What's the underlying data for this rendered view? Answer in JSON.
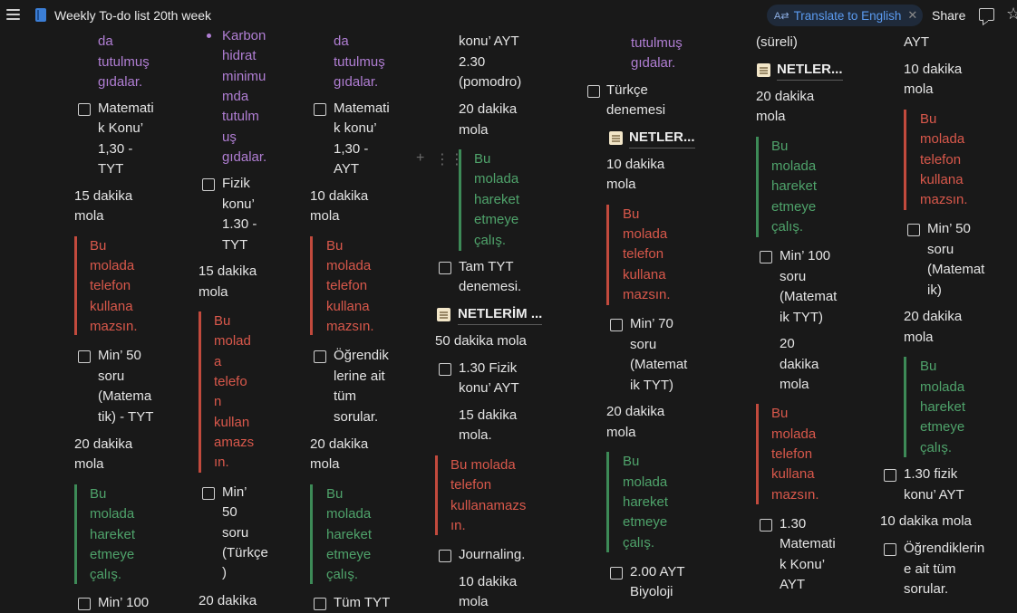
{
  "header": {
    "title": "Weekly To-do list 20th week",
    "translate_label": "Translate to English",
    "translate_icon": "translate-icon",
    "close_icon": "close-icon",
    "share_label": "Share",
    "comment_icon": "comment-icon",
    "favorite_icon": "star-icon"
  },
  "colors": {
    "background": "#191919",
    "purple": "#b07ed3",
    "red": "#d9584b",
    "green": "#4fa36b",
    "accent": "#5b9bf0"
  },
  "c1": {
    "p1": "da",
    "p2": "tutulmuş",
    "p3": "gıdalar.",
    "task1": [
      "Matemati",
      "k Konu’",
      "1,30 -",
      "TYT"
    ],
    "m1": [
      "15 dakika",
      "mola"
    ],
    "red1": [
      "Bu",
      "molada",
      "telefon",
      "kullana",
      "mazsın."
    ],
    "task2": [
      "Min’ 50",
      "soru",
      "(Matema",
      "tik) - TYT"
    ],
    "m2": [
      "20 dakika",
      "mola"
    ],
    "green1": [
      "Bu",
      "molada",
      "hareket",
      "etmeye",
      "çalış."
    ],
    "task3": "Min’ 100"
  },
  "c2": {
    "purple": [
      "Karbon",
      "hidrat",
      "minimu",
      "mda",
      "tutulm",
      "uş",
      "gıdalar."
    ],
    "task1": [
      "Fizik",
      "konu’",
      "1.30 -",
      "TYT"
    ],
    "m1": [
      "15 dakika",
      "mola"
    ],
    "red1": [
      "Bu",
      "molad",
      "a",
      "telefo",
      "n",
      "kullan",
      "amazs",
      "ın."
    ],
    "task2": [
      "Min’",
      "50",
      "soru",
      "(Türkçe",
      ")"
    ],
    "m2": "20 dakika"
  },
  "c3": {
    "p1": "da",
    "p2": "tutulmuş",
    "p3": "gıdalar.",
    "task1": [
      "Matemati",
      "k konu’",
      "1,30 -",
      "AYT"
    ],
    "m1": [
      "10 dakika",
      "mola"
    ],
    "red1": [
      "Bu",
      "molada",
      "telefon",
      "kullana",
      "mazsın."
    ],
    "task2": [
      "Öğrendik",
      "lerine ait",
      "tüm",
      "sorular."
    ],
    "m2": [
      "20 dakika",
      "mola"
    ],
    "green1": [
      "Bu",
      "molada",
      "hareket",
      "etmeye",
      "çalış."
    ],
    "task3": "Tüm TYT"
  },
  "c4": {
    "l1": [
      "konu’ AYT",
      "2.30",
      "(pomodro)"
    ],
    "m1": [
      "20 dakika",
      "mola"
    ],
    "green1": [
      "Bu",
      "molada",
      "hareket",
      "etmeye",
      "çalış."
    ],
    "task1": [
      "Tam TYT",
      "denemesi."
    ],
    "link1": "NETLERİM ...",
    "m2": "50 dakika mola",
    "task2": [
      "1.30 Fizik",
      "konu’ AYT"
    ],
    "m3": [
      "15 dakika",
      "mola."
    ],
    "red1": [
      "Bu molada",
      "telefon",
      "kullanamazs",
      "ın."
    ],
    "task3": "Journaling.",
    "m4": [
      "10 dakika",
      "mola"
    ]
  },
  "c5": {
    "purple": [
      "tutulmuş",
      "gıdalar."
    ],
    "task1": [
      "Türkçe",
      "denemesi"
    ],
    "link1": "NETLER...",
    "m1": [
      "10 dakika",
      "mola"
    ],
    "red1": [
      "Bu",
      "molada",
      "telefon",
      "kullana",
      "mazsın."
    ],
    "task2": [
      "Min’ 70",
      "soru",
      "(Matemat",
      "ik TYT)"
    ],
    "m2": [
      "20 dakika",
      "mola"
    ],
    "green1": [
      "Bu",
      "molada",
      "hareket",
      "etmeye",
      "çalış."
    ],
    "task3": [
      "2.00 AYT",
      "Biyoloji"
    ]
  },
  "c6": {
    "l1": "(süreli)",
    "link1": "NETLER...",
    "m1": [
      "20 dakika",
      "mola"
    ],
    "green1": [
      "Bu",
      "molada",
      "hareket",
      "etmeye",
      "çalış."
    ],
    "task1": [
      "Min’ 100",
      "soru",
      "(Matemat",
      "ik TYT)"
    ],
    "m2": [
      "20",
      "dakika",
      "mola"
    ],
    "red1": [
      "Bu",
      "molada",
      "telefon",
      "kullana",
      "mazsın."
    ],
    "task2": [
      "1.30",
      "Matemati",
      "k Konu’",
      "AYT"
    ]
  },
  "c7": {
    "l1": "AYT",
    "m1": [
      "10 dakika",
      "mola"
    ],
    "red1": [
      "Bu",
      "molada",
      "telefon",
      "kullana",
      "mazsın."
    ],
    "task1": [
      "Min’ 50",
      "soru",
      "(Matemat",
      "ik)"
    ],
    "m2": [
      "20 dakika",
      "mola"
    ],
    "green1": [
      "Bu",
      "molada",
      "hareket",
      "etmeye",
      "çalış."
    ],
    "task2": [
      "1.30 fizik",
      "konu’ AYT"
    ],
    "m3": "10 dakika mola",
    "task3": [
      "Öğrendiklerin",
      "e ait tüm",
      "sorular."
    ]
  }
}
